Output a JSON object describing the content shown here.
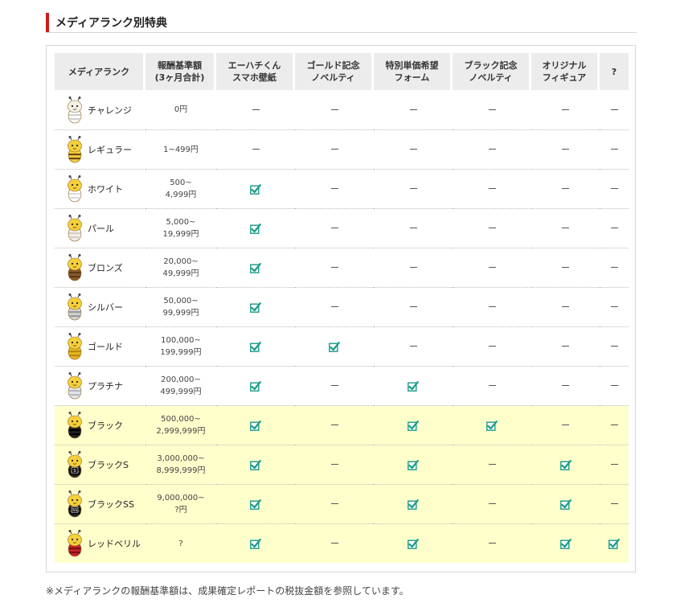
{
  "section_title": "メディアランク別特典",
  "headers": [
    {
      "lines": [
        "メディアランク"
      ]
    },
    {
      "lines": [
        "報酬基準額",
        "(3ヶ月合計)"
      ]
    },
    {
      "lines": [
        "エーハチくん",
        "スマホ壁紙"
      ]
    },
    {
      "lines": [
        "ゴールド記念",
        "ノベルティ"
      ]
    },
    {
      "lines": [
        "特別単価希望",
        "フォーム"
      ]
    },
    {
      "lines": [
        "ブラック記念",
        "ノベルティ"
      ]
    },
    {
      "lines": [
        "オリジナル",
        "フィギュア"
      ]
    },
    {
      "lines": [
        "?"
      ]
    }
  ],
  "rows": [
    {
      "name": "チャレンジ",
      "amount": [
        "0円"
      ],
      "benefits": [
        false,
        false,
        false,
        false,
        false,
        false
      ],
      "highlight": false,
      "mascot": {
        "head": "#f4f1e4",
        "body": "#ffffff",
        "stripe": "#cfcfcf",
        "badge": ""
      }
    },
    {
      "name": "レギュラー",
      "amount": [
        "1~499円"
      ],
      "benefits": [
        false,
        false,
        false,
        false,
        false,
        false
      ],
      "highlight": false,
      "mascot": {
        "head": "#f6cf3a",
        "body": "#f6cf3a",
        "stripe": "#6b4a1a",
        "badge": ""
      }
    },
    {
      "name": "ホワイト",
      "amount": [
        "500~",
        "4,999円"
      ],
      "benefits": [
        true,
        false,
        false,
        false,
        false,
        false
      ],
      "highlight": false,
      "mascot": {
        "head": "#f6cf3a",
        "body": "#ffffff",
        "stripe": "#dddddd",
        "badge": ""
      }
    },
    {
      "name": "パール",
      "amount": [
        "5,000~",
        "19,999円"
      ],
      "benefits": [
        true,
        false,
        false,
        false,
        false,
        false
      ],
      "highlight": false,
      "mascot": {
        "head": "#f6cf3a",
        "body": "#f3eee8",
        "stripe": "#d8cfc4",
        "badge": ""
      }
    },
    {
      "name": "ブロンズ",
      "amount": [
        "20,000~",
        "49,999円"
      ],
      "benefits": [
        true,
        false,
        false,
        false,
        false,
        false
      ],
      "highlight": false,
      "mascot": {
        "head": "#f6cf3a",
        "body": "#8a5a2b",
        "stripe": "#5c3a18",
        "badge": ""
      }
    },
    {
      "name": "シルバー",
      "amount": [
        "50,000~",
        "99,999円"
      ],
      "benefits": [
        true,
        false,
        false,
        false,
        false,
        false
      ],
      "highlight": false,
      "mascot": {
        "head": "#f6cf3a",
        "body": "#d4d4d4",
        "stripe": "#9a9a9a",
        "badge": ""
      }
    },
    {
      "name": "ゴールド",
      "amount": [
        "100,000~",
        "199,999円"
      ],
      "benefits": [
        true,
        true,
        false,
        false,
        false,
        false
      ],
      "highlight": false,
      "mascot": {
        "head": "#f6cf3a",
        "body": "#e8b820",
        "stripe": "#b98a10",
        "badge": ""
      }
    },
    {
      "name": "プラチナ",
      "amount": [
        "200,000~",
        "499,999円"
      ],
      "benefits": [
        true,
        false,
        true,
        false,
        false,
        false
      ],
      "highlight": false,
      "mascot": {
        "head": "#f6cf3a",
        "body": "#e6e6ec",
        "stripe": "#b8b8c2",
        "badge": ""
      }
    },
    {
      "name": "ブラック",
      "amount": [
        "500,000~",
        "2,999,999円"
      ],
      "benefits": [
        true,
        false,
        true,
        true,
        false,
        false
      ],
      "highlight": true,
      "mascot": {
        "head": "#f6cf3a",
        "body": "#222222",
        "stripe": "#000000",
        "badge": ""
      }
    },
    {
      "name": "ブラックS",
      "amount": [
        "3,000,000~",
        "8,999,999円"
      ],
      "benefits": [
        true,
        false,
        true,
        false,
        true,
        false
      ],
      "highlight": true,
      "mascot": {
        "head": "#f6cf3a",
        "body": "#222222",
        "stripe": "#000000",
        "badge": "S"
      }
    },
    {
      "name": "ブラックSS",
      "amount": [
        "9,000,000~",
        "?円"
      ],
      "benefits": [
        true,
        false,
        true,
        false,
        true,
        false
      ],
      "highlight": true,
      "mascot": {
        "head": "#f6cf3a",
        "body": "#222222",
        "stripe": "#000000",
        "badge": "SS"
      }
    },
    {
      "name": "レッドベリル",
      "amount": [
        "?"
      ],
      "benefits": [
        true,
        false,
        true,
        false,
        true,
        true
      ],
      "highlight": true,
      "mascot": {
        "head": "#f6cf3a",
        "body": "#c8232a",
        "stripe": "#7a1015",
        "badge": ""
      }
    }
  ],
  "footnote": "※メディアランクの報酬基準額は、成果確定レポートの税抜金額を参照しています。",
  "colors": {
    "accent": "#cc1b1b",
    "check": "#1a9a8a",
    "highlight_row": "#ffffcc",
    "header_bg": "#ececec"
  }
}
